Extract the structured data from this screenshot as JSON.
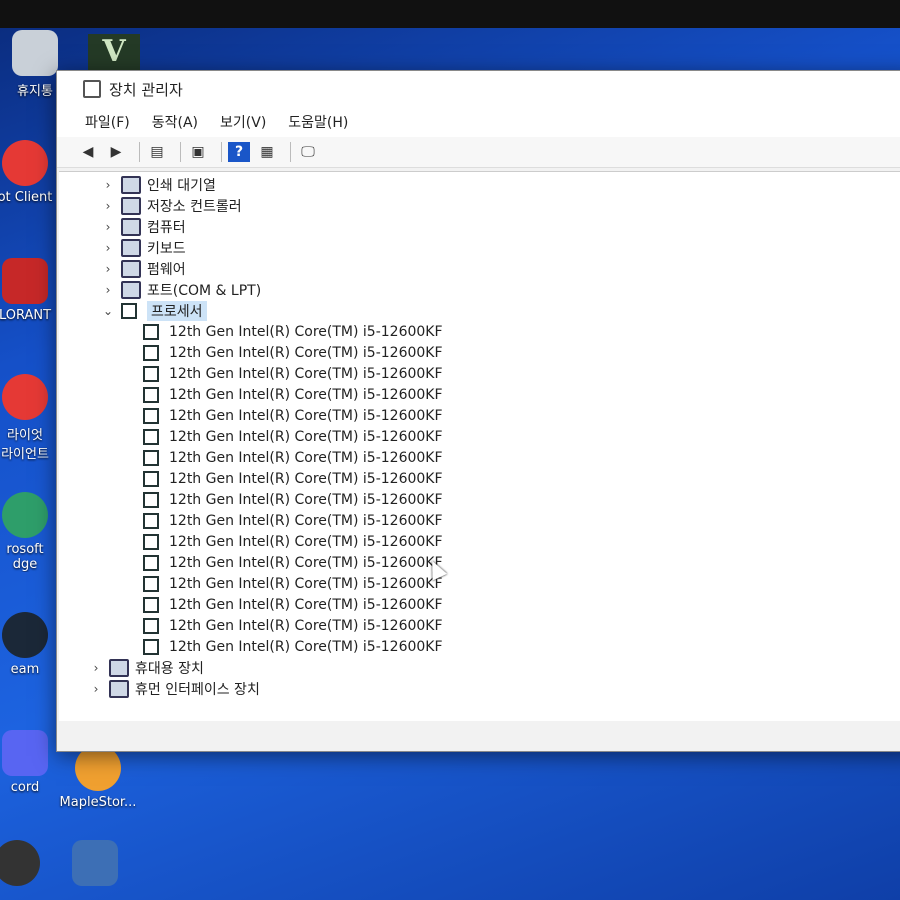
{
  "desktop": {
    "icons": [
      {
        "label": "휴지통",
        "color": "#c9d0d8"
      },
      {
        "label": "ot Client",
        "color": "#e53935"
      },
      {
        "label": "LORANT",
        "color": "#c62828"
      },
      {
        "label": "라이엇\n라이언트",
        "color": "#e53935"
      },
      {
        "label": "rosoft\ndge",
        "color": "#2e9e6a"
      },
      {
        "label": "eam",
        "color": "#1b2838"
      },
      {
        "label": "cord",
        "color": "#5865f2"
      },
      {
        "label": "MapleStor...",
        "color": "#f0a030"
      }
    ]
  },
  "window": {
    "title": "장치 관리자",
    "menu": [
      "파일(F)",
      "동작(A)",
      "보기(V)",
      "도움말(H)"
    ]
  },
  "tree": {
    "before": [
      {
        "label": "인쇄 대기열",
        "icon": "printer-icon"
      },
      {
        "label": "저장소 컨트롤러",
        "icon": "storage-icon"
      },
      {
        "label": "컴퓨터",
        "icon": "computer-icon"
      },
      {
        "label": "키보드",
        "icon": "keyboard-icon"
      },
      {
        "label": "펌웨어",
        "icon": "firmware-icon"
      },
      {
        "label": "포트(COM & LPT)",
        "icon": "port-icon"
      }
    ],
    "expanded": {
      "label": "프로세서",
      "icon": "processor-icon"
    },
    "processors": [
      "12th Gen Intel(R) Core(TM) i5-12600KF",
      "12th Gen Intel(R) Core(TM) i5-12600KF",
      "12th Gen Intel(R) Core(TM) i5-12600KF",
      "12th Gen Intel(R) Core(TM) i5-12600KF",
      "12th Gen Intel(R) Core(TM) i5-12600KF",
      "12th Gen Intel(R) Core(TM) i5-12600KF",
      "12th Gen Intel(R) Core(TM) i5-12600KF",
      "12th Gen Intel(R) Core(TM) i5-12600KF",
      "12th Gen Intel(R) Core(TM) i5-12600KF",
      "12th Gen Intel(R) Core(TM) i5-12600KF",
      "12th Gen Intel(R) Core(TM) i5-12600KF",
      "12th Gen Intel(R) Core(TM) i5-12600KF",
      "12th Gen Intel(R) Core(TM) i5-12600KF",
      "12th Gen Intel(R) Core(TM) i5-12600KF",
      "12th Gen Intel(R) Core(TM) i5-12600KF",
      "12th Gen Intel(R) Core(TM) i5-12600KF"
    ],
    "after": [
      {
        "label": "휴대용 장치",
        "icon": "portable-device-icon"
      },
      {
        "label": "휴먼 인터페이스 장치",
        "icon": "hid-icon"
      }
    ]
  }
}
